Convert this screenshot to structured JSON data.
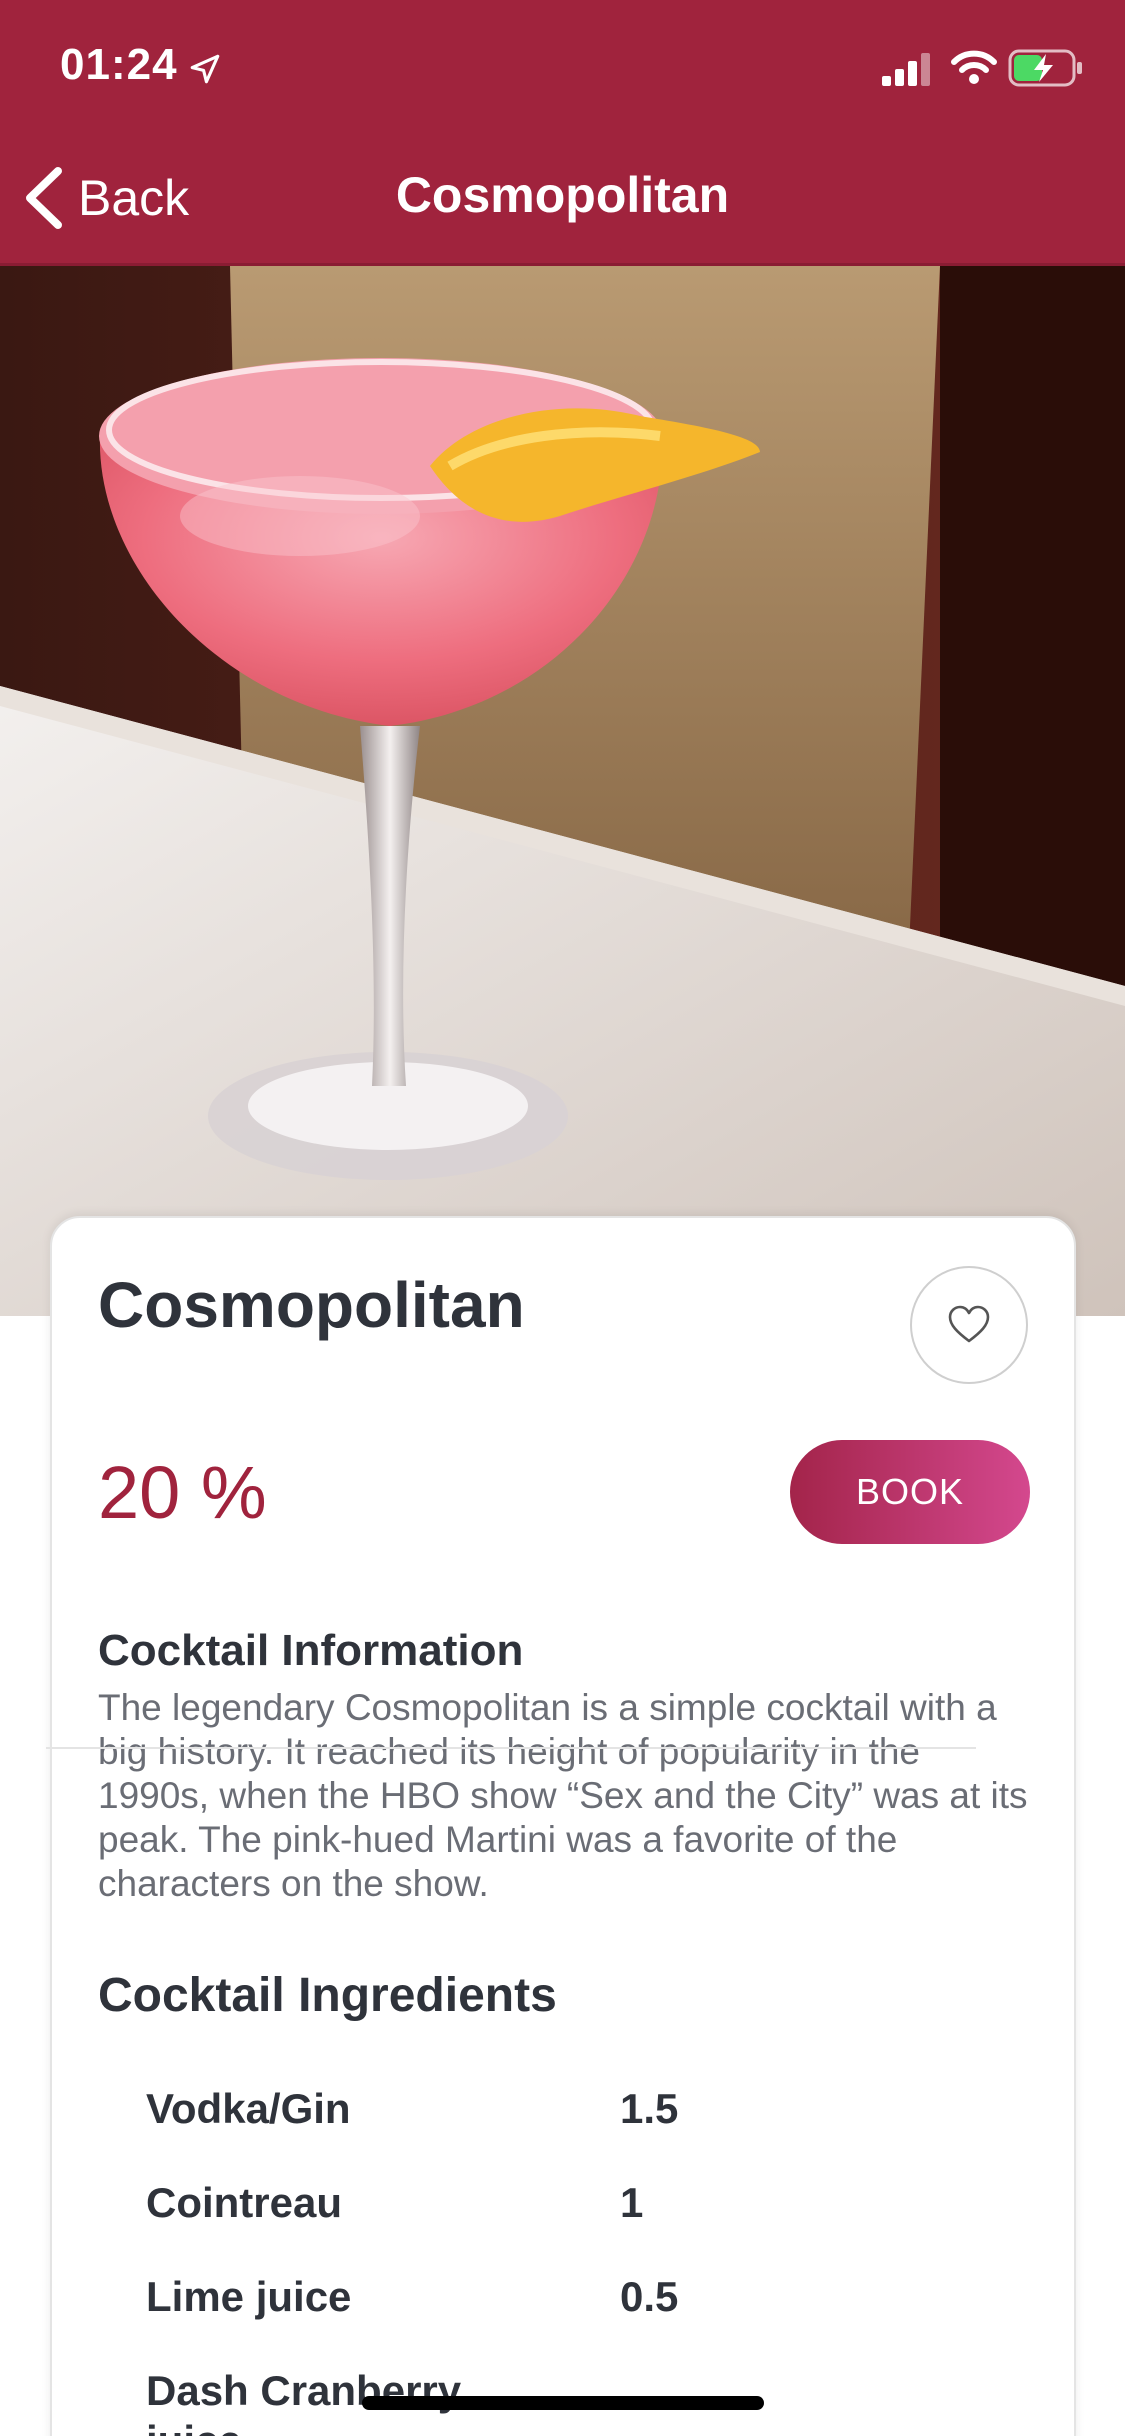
{
  "status_bar": {
    "time": "01:24",
    "icons": [
      "location-arrow-icon",
      "cellular-signal-icon",
      "wifi-icon",
      "battery-charging-icon"
    ]
  },
  "nav": {
    "back_label": "Back",
    "title": "Cosmopolitan"
  },
  "hero": {
    "image": "cocktail-photo",
    "page_count": 1,
    "active_page": 1
  },
  "card": {
    "name": "Cosmopolitan",
    "favorite_icon": "heart-outline-icon",
    "alcohol": "20 %",
    "book_label": "BOOK",
    "info_heading": "Cocktail Information",
    "info_text": "The legendary Cosmopolitan is a simple cocktail with a big history. It reached its height of popularity in the 1990s, when the HBO show “Sex and the City” was at its peak. The pink-hued Martini was a favorite of the characters on the show.",
    "ingredients_heading": "Cocktail Ingredients",
    "ingredients": [
      {
        "name": "Vodka/Gin",
        "qty": "1.5"
      },
      {
        "name": "Cointreau",
        "qty": "1"
      },
      {
        "name": "Lime juice",
        "qty": "0.5"
      },
      {
        "name": "Dash Cranberry juice",
        "qty": ""
      }
    ]
  },
  "colors": {
    "brand": "#a0233d",
    "text_dark": "#2f333b",
    "text_muted": "#6a6d75",
    "book_gradient_start": "#a3244a",
    "book_gradient_end": "#d4488e"
  }
}
